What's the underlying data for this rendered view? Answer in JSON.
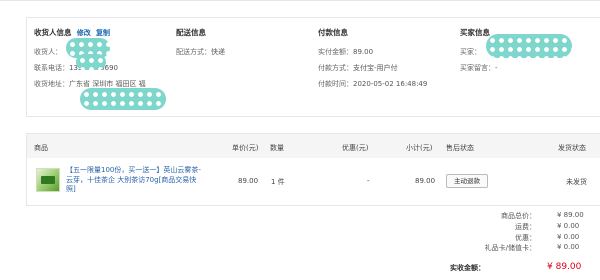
{
  "receiver": {
    "title": "收货人信息",
    "edit_label": "修改",
    "copy_label": "复制",
    "name_label": "收货人：",
    "phone_label": "联系电话：",
    "phone_value": "13590360690",
    "address_label": "收货地址：",
    "address_value": "广东省 深圳市 福田区 福"
  },
  "shipping": {
    "title": "配送信息",
    "method_label": "配送方式：",
    "method_value": "快递"
  },
  "payment": {
    "title": "付款信息",
    "amount_label": "实付金额：",
    "amount_value": "89.00",
    "method_label": "付款方式：",
    "method_value": "支付宝-用户付",
    "time_label": "付款时间：",
    "time_value": "2020-05-02 16:48:49"
  },
  "buyer": {
    "title": "买家信息",
    "buyer_label": "买家：",
    "message_label": "买家留言：",
    "message_value": "-"
  },
  "table": {
    "headers": {
      "product": "商品",
      "unit_price": "单价(元)",
      "quantity": "数量",
      "discount": "优惠(元)",
      "subtotal": "小计(元)",
      "after_sale": "售后状态",
      "ship_status": "发货状态"
    },
    "row": {
      "title": "【五一限量100份，买一送一】英山云雾茶-云芽，十佳茶企 大别茶访70g[商品交易快照]",
      "unit_price": "89.00",
      "quantity": "1 件",
      "discount": "-",
      "subtotal": "89.00",
      "action_label": "主动退款",
      "ship_status": "未发货"
    }
  },
  "summary": {
    "items": [
      {
        "label": "商品总价：",
        "value": "¥ 89.00"
      },
      {
        "label": "运费：",
        "value": "¥ 0.00"
      },
      {
        "label": "优惠：",
        "value": "¥ 0.00"
      },
      {
        "label": "礼品卡/储值卡：",
        "value": "¥ 0.00"
      }
    ],
    "total_label": "实收金额：",
    "total_value": "¥ 89.00"
  },
  "colors": {
    "link": "#1a66b3",
    "accent_red": "#d9001b",
    "redaction_blob": "#7fd6cc"
  }
}
